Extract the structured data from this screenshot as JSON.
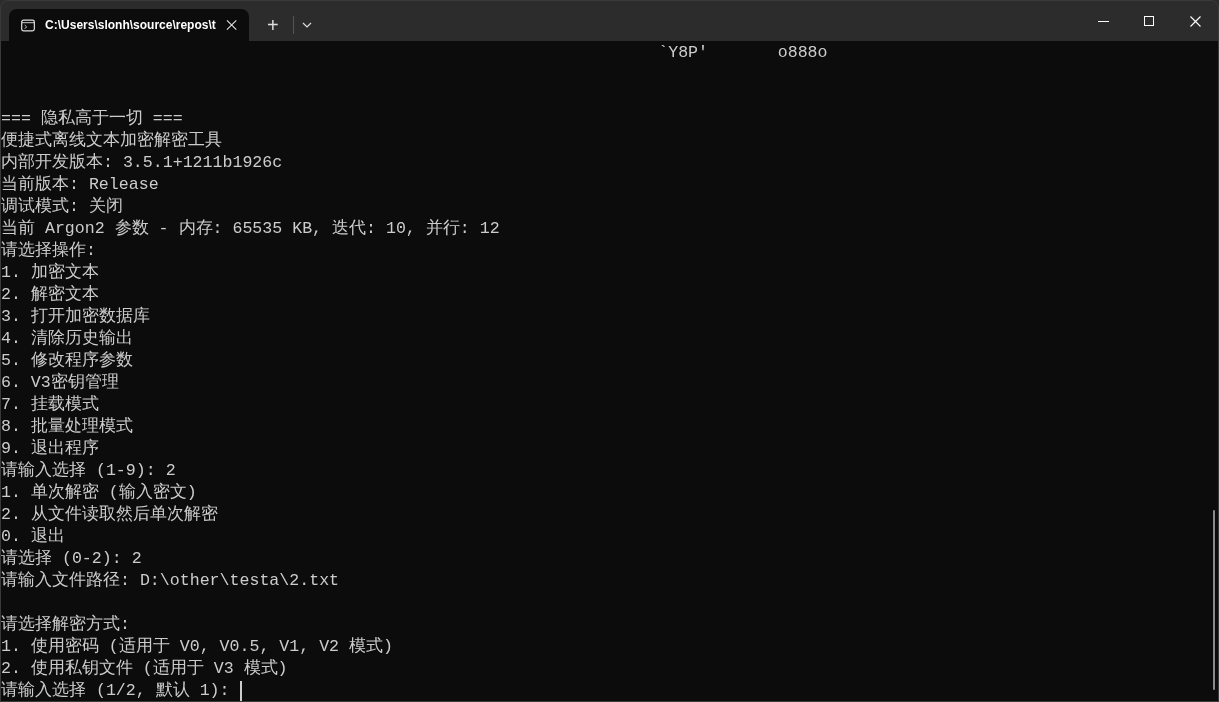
{
  "tab": {
    "title": "C:\\Users\\slonh\\source\\repos\\t",
    "selected": true
  },
  "new_tab": "+",
  "terminal": {
    "lines": [
      {
        "kind": "text",
        "text": "                                                                  `Y8P'       o888o"
      },
      {
        "kind": "blank"
      },
      {
        "kind": "blank"
      },
      {
        "kind": "text",
        "text": "=== 隐私高于一切 ==="
      },
      {
        "kind": "text",
        "text": "便捷式离线文本加密解密工具"
      },
      {
        "kind": "text",
        "text": "内部开发版本: 3.5.1+1211b1926c"
      },
      {
        "kind": "text",
        "text": "当前版本: Release"
      },
      {
        "kind": "text",
        "text": "调试模式: 关闭"
      },
      {
        "kind": "text",
        "text": "当前 Argon2 参数 - 内存: 65535 KB, 迭代: 10, 并行: 12"
      },
      {
        "kind": "text",
        "text": "请选择操作:"
      },
      {
        "kind": "text",
        "text": "1. 加密文本"
      },
      {
        "kind": "text",
        "text": "2. 解密文本"
      },
      {
        "kind": "text",
        "text": "3. 打开加密数据库"
      },
      {
        "kind": "text",
        "text": "4. 清除历史输出"
      },
      {
        "kind": "text",
        "text": "5. 修改程序参数"
      },
      {
        "kind": "text",
        "text": "6. V3密钥管理"
      },
      {
        "kind": "text",
        "text": "7. 挂载模式"
      },
      {
        "kind": "text",
        "text": "8. 批量处理模式"
      },
      {
        "kind": "text",
        "text": "9. 退出程序"
      },
      {
        "kind": "text",
        "text": "请输入选择 (1-9): 2"
      },
      {
        "kind": "text",
        "text": "1. 单次解密 (输入密文)"
      },
      {
        "kind": "text",
        "text": "2. 从文件读取然后单次解密"
      },
      {
        "kind": "text",
        "text": "0. 退出"
      },
      {
        "kind": "text",
        "text": "请选择 (0-2): 2"
      },
      {
        "kind": "text",
        "text": "请输入文件路径: D:\\other\\testa\\2.txt"
      },
      {
        "kind": "blank"
      },
      {
        "kind": "text",
        "text": "请选择解密方式:"
      },
      {
        "kind": "text",
        "text": "1. 使用密码 (适用于 V0, V0.5, V1, V2 模式)"
      },
      {
        "kind": "text",
        "text": "2. 使用私钥文件 (适用于 V3 模式)"
      },
      {
        "kind": "prompt",
        "text": "请输入选择 (1/2, 默认 1): "
      }
    ]
  }
}
